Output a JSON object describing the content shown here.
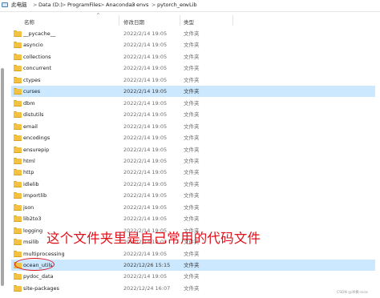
{
  "address_bar": {
    "crumbs": [
      "此电脑",
      "Data (D:)",
      "ProgramFiles",
      "Anaconda3",
      "envs",
      "pytorch_env",
      "Lib"
    ],
    "separator": ">"
  },
  "columns": {
    "name": "名称",
    "date": "修改日期",
    "type": "类型"
  },
  "rows": [
    {
      "name": "__pycache__",
      "date": "2022/2/14 19:05",
      "type": "文件夹",
      "selected": false
    },
    {
      "name": "asyncio",
      "date": "2022/2/14 19:05",
      "type": "文件夹",
      "selected": false
    },
    {
      "name": "collections",
      "date": "2022/2/14 19:05",
      "type": "文件夹",
      "selected": false
    },
    {
      "name": "concurrent",
      "date": "2022/2/14 19:05",
      "type": "文件夹",
      "selected": false
    },
    {
      "name": "ctypes",
      "date": "2022/2/14 19:05",
      "type": "文件夹",
      "selected": false
    },
    {
      "name": "curses",
      "date": "2022/2/14 19:05",
      "type": "文件夹",
      "selected": true
    },
    {
      "name": "dbm",
      "date": "2022/2/14 19:05",
      "type": "文件夹",
      "selected": false
    },
    {
      "name": "distutils",
      "date": "2022/2/14 19:05",
      "type": "文件夹",
      "selected": false
    },
    {
      "name": "email",
      "date": "2022/2/14 19:05",
      "type": "文件夹",
      "selected": false
    },
    {
      "name": "encodings",
      "date": "2022/2/14 19:05",
      "type": "文件夹",
      "selected": false
    },
    {
      "name": "ensurepip",
      "date": "2022/2/14 19:05",
      "type": "文件夹",
      "selected": false
    },
    {
      "name": "html",
      "date": "2022/2/14 19:05",
      "type": "文件夹",
      "selected": false
    },
    {
      "name": "http",
      "date": "2022/2/14 19:05",
      "type": "文件夹",
      "selected": false
    },
    {
      "name": "idlelib",
      "date": "2022/2/14 19:05",
      "type": "文件夹",
      "selected": false
    },
    {
      "name": "importlib",
      "date": "2022/2/14 19:05",
      "type": "文件夹",
      "selected": false
    },
    {
      "name": "json",
      "date": "2022/2/14 19:05",
      "type": "文件夹",
      "selected": false
    },
    {
      "name": "lib2to3",
      "date": "2022/2/14 19:05",
      "type": "文件夹",
      "selected": false
    },
    {
      "name": "logging",
      "date": "2022/2/14 19:05",
      "type": "文件夹",
      "selected": false
    },
    {
      "name": "msilib",
      "date": "2022/2/14 19:05",
      "type": "文件夹",
      "selected": false
    },
    {
      "name": "multiprocessing",
      "date": "2022/2/14 19:05",
      "type": "文件夹",
      "selected": false
    },
    {
      "name": "ocean_utils",
      "date": "2022/12/26 15:15",
      "type": "文件夹",
      "selected": true
    },
    {
      "name": "pydoc_data",
      "date": "2022/2/14 19:05",
      "type": "文件夹",
      "selected": false
    },
    {
      "name": "site-packages",
      "date": "2022/12/24 16:07",
      "type": "文件夹",
      "selected": false
    }
  ],
  "annotation": "这个文件夹里是自己常用的代码文件",
  "watermark": "CSDN @冰枫-nice",
  "colors": {
    "selection": "#cce8ff",
    "annotation": "#e0101a",
    "folder": "#f4c242"
  },
  "icons": [
    "computer-icon",
    "folder-icon",
    "sort-up-icon"
  ]
}
